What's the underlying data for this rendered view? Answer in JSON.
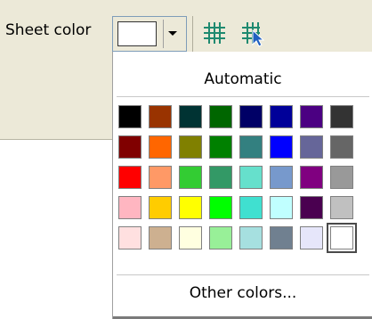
{
  "toolbar": {
    "sheet_color_label": "Sheet color",
    "current_color": "#ffffff",
    "show_grid_icon": "grid-icon",
    "grid_cursor_icon": "grid-cursor-icon",
    "grid_color": "#1f8a70"
  },
  "popup": {
    "automatic_label": "Automatic",
    "other_colors_label": "Other colors...",
    "selected_color": "#ffffff",
    "palette": [
      [
        "#000000",
        "#993300",
        "#003333",
        "#006600",
        "#000066",
        "#000099",
        "#4b0082",
        "#333333"
      ],
      [
        "#800000",
        "#ff6600",
        "#808000",
        "#008000",
        "#338080",
        "#0000ff",
        "#666699",
        "#666666"
      ],
      [
        "#ff0000",
        "#ff9966",
        "#33cc33",
        "#339966",
        "#66e0cc",
        "#7799cc",
        "#800080",
        "#999999"
      ],
      [
        "#ffb6c1",
        "#ffcc00",
        "#ffff00",
        "#00ff00",
        "#40e0d0",
        "#c0ffff",
        "#4a0050",
        "#c0c0c0"
      ],
      [
        "#ffe0e0",
        "#cdb090",
        "#ffffe0",
        "#98f098",
        "#a6e0e0",
        "#708090",
        "#e6e6fa",
        "#ffffff"
      ]
    ]
  }
}
